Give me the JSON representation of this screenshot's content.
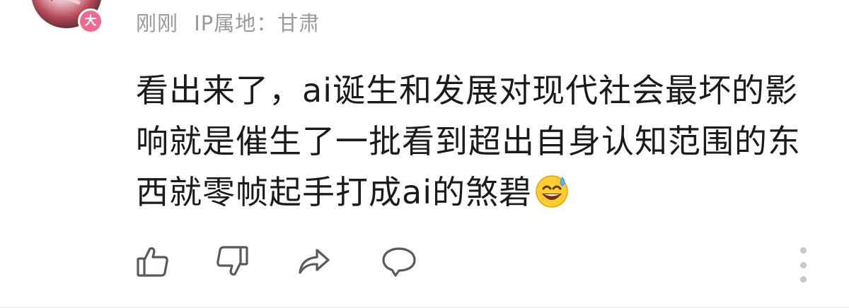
{
  "comment": {
    "level_badge": "大",
    "time": "刚刚",
    "ip_label": "IP属地：甘肃",
    "text": "看出来了，ai诞生和发展对现代社会最坏的影响就是催生了一批看到超出自身认知范围的东西就零帧起手打成ai的煞碧",
    "emoji": "sweat-smile-emoji"
  },
  "actions": {
    "like_icon": "thumbs-up-icon",
    "dislike_icon": "thumbs-down-icon",
    "share_icon": "share-arrow-icon",
    "reply_icon": "comment-bubble-icon",
    "more_icon": "more-vertical-icon"
  },
  "colors": {
    "meta_text": "#9a9a9a",
    "body_text": "#1b1b1b",
    "badge": "#f06a90",
    "icon_stroke": "#5a5a5a"
  }
}
